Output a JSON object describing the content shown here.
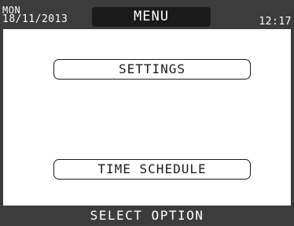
{
  "header": {
    "day": "MON",
    "date": "18/11/2013",
    "title": "MENU",
    "time": "12:17"
  },
  "menu": {
    "options": [
      {
        "label": "SETTINGS"
      },
      {
        "label": "TIME SCHEDULE"
      }
    ]
  },
  "footer": {
    "prompt": "SELECT OPTION"
  },
  "colors": {
    "frame": "#3c3c3c",
    "title_bar": "#1a1a1a",
    "content_bg": "#ffffff",
    "text_light": "#ffffff",
    "text_dark": "#1a1a1a"
  }
}
